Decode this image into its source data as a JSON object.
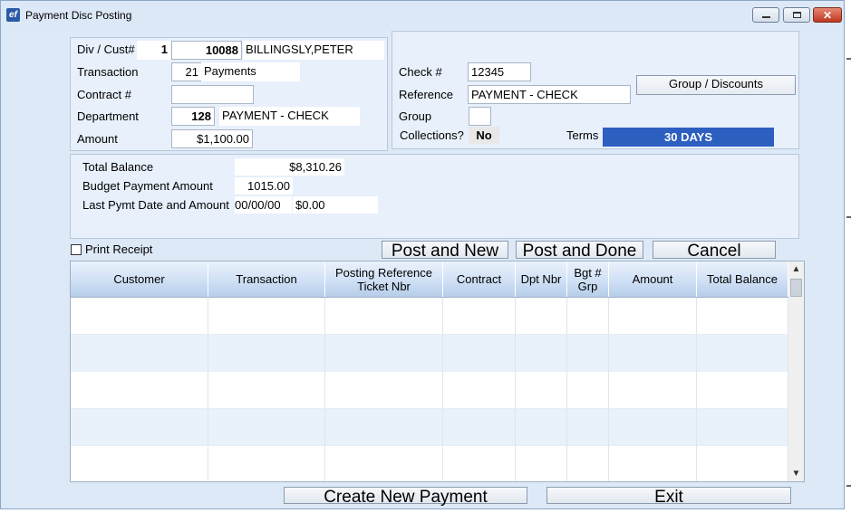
{
  "window": {
    "title": "Payment Disc Posting",
    "icon": "ef",
    "controls": {
      "close": "✕"
    }
  },
  "customer": {
    "div_cust_label": "Div / Cust#",
    "div": "1",
    "cust_no": "10088",
    "cust_name": "BILLINGSLY,PETER",
    "transaction_label": "Transaction",
    "transaction_code": "21",
    "transaction_desc": "Payments",
    "contract_label": "Contract #",
    "contract_value": "",
    "department_label": "Department",
    "department_code": "128",
    "department_desc": "PAYMENT - CHECK",
    "amount_label": "Amount",
    "amount_value": "$1,100.00"
  },
  "check": {
    "check_label": "Check #",
    "check_value": "12345",
    "reference_label": "Reference",
    "reference_value": "PAYMENT - CHECK",
    "group_label": "Group",
    "group_value": "",
    "collections_label": "Collections?",
    "collections_value": "No",
    "terms_label": "Terms",
    "terms_value": "30 DAYS",
    "group_discounts_button": "Group / Discounts"
  },
  "balance": {
    "total_balance_label": "Total Balance",
    "total_balance_value": "$8,310.26",
    "budget_label": "Budget Payment Amount",
    "budget_value": "1015.00",
    "last_pymt_label": "Last Pymt Date and Amount",
    "last_pymt_date": "00/00/00",
    "last_pymt_amount": "$0.00"
  },
  "actions": {
    "print_receipt_label": "Print Receipt",
    "print_receipt_checked": false,
    "post_and_new": "Post and New",
    "post_and_done": "Post and Done",
    "cancel": "Cancel"
  },
  "grid": {
    "columns": [
      {
        "line1": "Customer",
        "line2": ""
      },
      {
        "line1": "Transaction",
        "line2": ""
      },
      {
        "line1": "Posting Reference",
        "line2": "Ticket Nbr"
      },
      {
        "line1": "Contract",
        "line2": ""
      },
      {
        "line1": "Dpt Nbr",
        "line2": ""
      },
      {
        "line1": "Bgt #",
        "line2": "Grp"
      },
      {
        "line1": "Amount",
        "line2": ""
      },
      {
        "line1": "Total Balance",
        "line2": ""
      }
    ],
    "rows": [
      [
        "",
        "",
        "",
        "",
        "",
        "",
        "",
        ""
      ],
      [
        "",
        "",
        "",
        "",
        "",
        "",
        "",
        ""
      ],
      [
        "",
        "",
        "",
        "",
        "",
        "",
        "",
        ""
      ],
      [
        "",
        "",
        "",
        "",
        "",
        "",
        "",
        ""
      ],
      [
        "",
        "",
        "",
        "",
        "",
        "",
        "",
        ""
      ]
    ],
    "scroll_up": "▲",
    "scroll_down": "▼"
  },
  "footer": {
    "create_new_payment": "Create New Payment",
    "exit": "Exit"
  },
  "colors": {
    "window_bg": "#dde9f7",
    "terms_bg": "#2c5fc0",
    "row_alt": "#e9f1fb"
  }
}
